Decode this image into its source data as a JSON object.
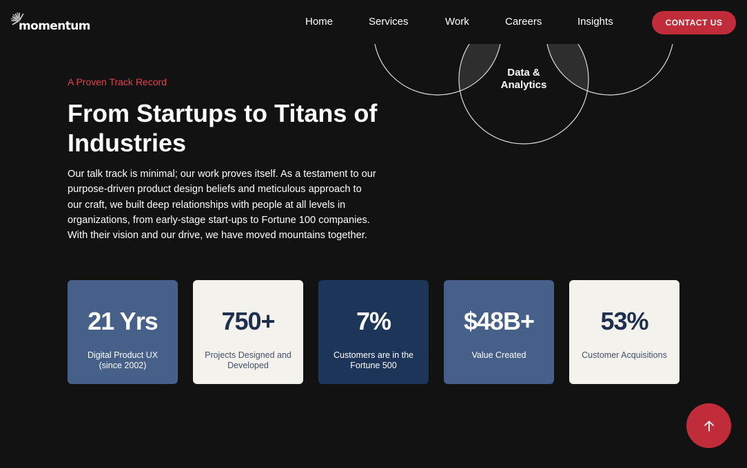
{
  "header": {
    "logo_text": "momentum",
    "nav": [
      "Home",
      "Services",
      "Work",
      "Careers",
      "Insights"
    ],
    "contact_label": "CONTACT US"
  },
  "graphic": {
    "label_line1": "Data &",
    "label_line2": "Analytics"
  },
  "hero": {
    "eyebrow": "A Proven Track Record",
    "headline": "From Startups to Titans of Industries",
    "intro": "Our talk track is minimal; our work proves itself. As a testament to our purpose-driven product design beliefs and meticulous approach to our craft, we built deep relationships with people at all levels in organizations, from early-stage start-ups to Fortune 100 companies. With their vision and our drive, we have moved mountains together."
  },
  "stats": [
    {
      "value": "21 Yrs",
      "label": "Digital Product UX (since 2002)"
    },
    {
      "value": "750+",
      "label": "Projects Designed and Developed"
    },
    {
      "value": "7%",
      "label": "Customers are in the Fortune 500"
    },
    {
      "value": "$48B+",
      "label": "Value Created"
    },
    {
      "value": "53%",
      "label": "Customer Acquisitions"
    }
  ],
  "colors": {
    "background": "#121212",
    "accent": "#c12c3a",
    "eyebrow": "#e0414e",
    "card_blue": "#46608a",
    "card_navy": "#1e355a",
    "card_light": "#f3f2ed"
  },
  "icons": {
    "logo": "radial-burst-icon",
    "scroll_top": "arrow-up-icon"
  }
}
